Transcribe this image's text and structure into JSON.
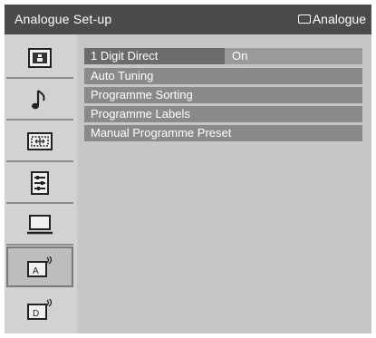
{
  "header": {
    "title": "Analogue Set-up",
    "source_label": "Analogue",
    "source_icon": "tv-input-icon"
  },
  "sidebar": {
    "items": [
      {
        "icon": "picture-icon",
        "active": false
      },
      {
        "icon": "music-note-icon",
        "active": false
      },
      {
        "icon": "screen-icon",
        "active": false
      },
      {
        "icon": "features-icon",
        "active": false
      },
      {
        "icon": "setup-monitor-icon",
        "active": false
      },
      {
        "icon": "analogue-antenna-icon",
        "active": true
      },
      {
        "icon": "digital-antenna-icon",
        "active": false
      }
    ]
  },
  "menu": {
    "items": [
      {
        "label": "1 Digit Direct",
        "value": "On",
        "selected": true
      },
      {
        "label": "Auto Tuning"
      },
      {
        "label": "Programme Sorting"
      },
      {
        "label": "Programme Labels"
      },
      {
        "label": "Manual Programme Preset"
      }
    ]
  },
  "colors": {
    "header_bg": "#4b4b4b",
    "sidebar_bg": "#d2d2d2",
    "main_bg": "#c6c6c6",
    "row_bg": "#8a8a8a",
    "selected_label_bg": "#6b6b6b"
  }
}
